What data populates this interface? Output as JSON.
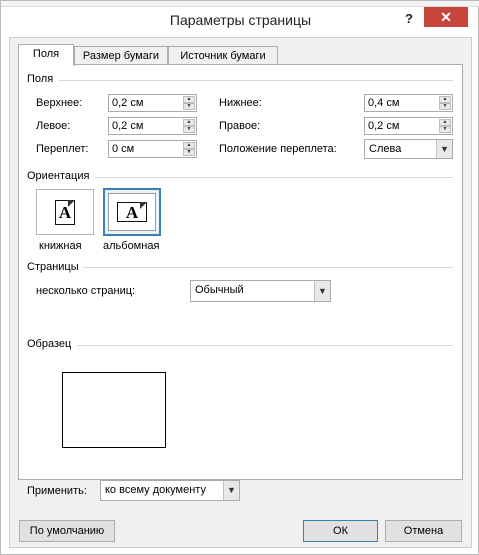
{
  "window": {
    "title": "Параметры страницы",
    "help": "?",
    "close": "✕"
  },
  "tabs": [
    {
      "label": "Поля",
      "active": true
    },
    {
      "label": "Размер бумаги",
      "active": false
    },
    {
      "label": "Источник бумаги",
      "active": false
    }
  ],
  "margins": {
    "section": "Поля",
    "top_label": "Верхнее:",
    "top_value": "0,2 см",
    "bottom_label": "Нижнее:",
    "bottom_value": "0,4 см",
    "left_label": "Левое:",
    "left_value": "0,2 см",
    "right_label": "Правое:",
    "right_value": "0,2 см",
    "gutter_label": "Переплет:",
    "gutter_value": "0 см",
    "gutter_pos_label": "Положение переплета:",
    "gutter_pos_value": "Слева"
  },
  "orientation": {
    "section": "Ориентация",
    "glyph": "A",
    "portrait": "книжная",
    "landscape": "альбомная",
    "selected": "landscape"
  },
  "pages": {
    "section": "Страницы",
    "multiple_label": "несколько страниц:",
    "multiple_value": "Обычный"
  },
  "preview": {
    "section": "Образец"
  },
  "apply": {
    "label": "Применить:",
    "value": "ко всему документу"
  },
  "buttons": {
    "default": "По умолчанию",
    "ok": "ОК",
    "cancel": "Отмена"
  },
  "icons": {
    "spin_up": "▲",
    "spin_down": "▼",
    "dropdown": "▼"
  }
}
